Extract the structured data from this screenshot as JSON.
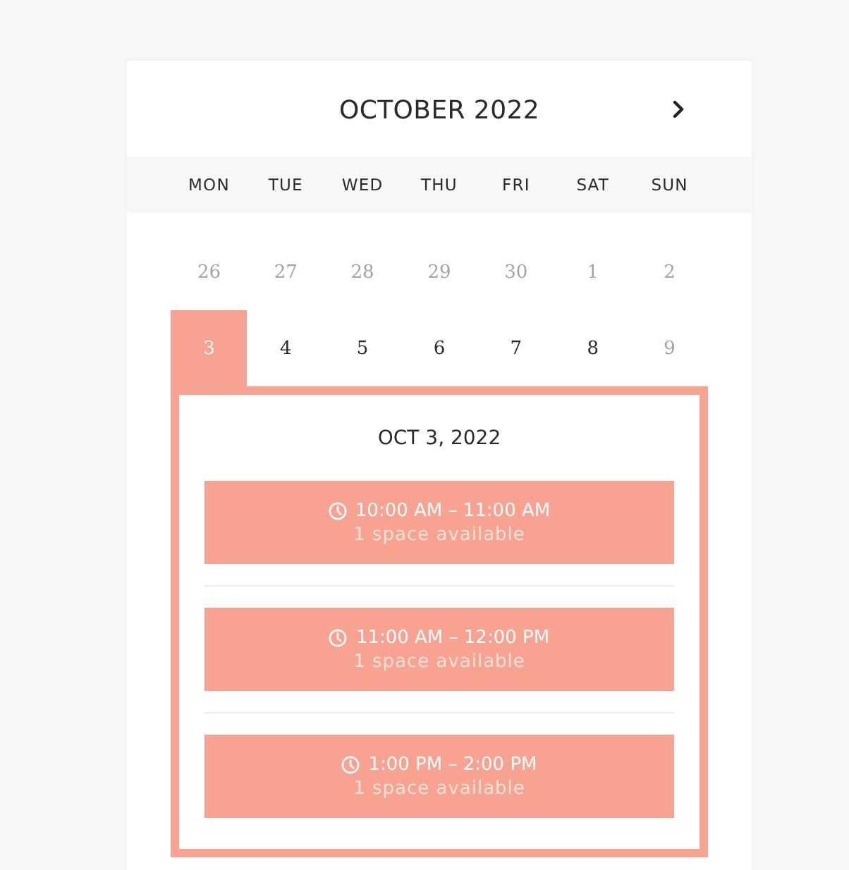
{
  "calendar": {
    "title": "OCTOBER 2022",
    "weekdays": [
      "MON",
      "TUE",
      "WED",
      "THU",
      "FRI",
      "SAT",
      "SUN"
    ],
    "weeks": [
      [
        {
          "day": "26",
          "available": false,
          "selected": false
        },
        {
          "day": "27",
          "available": false,
          "selected": false
        },
        {
          "day": "28",
          "available": false,
          "selected": false
        },
        {
          "day": "29",
          "available": false,
          "selected": false
        },
        {
          "day": "30",
          "available": false,
          "selected": false
        },
        {
          "day": "1",
          "available": false,
          "selected": false
        },
        {
          "day": "2",
          "available": false,
          "selected": false
        }
      ],
      [
        {
          "day": "3",
          "available": true,
          "selected": true
        },
        {
          "day": "4",
          "available": true,
          "selected": false
        },
        {
          "day": "5",
          "available": true,
          "selected": false
        },
        {
          "day": "6",
          "available": true,
          "selected": false
        },
        {
          "day": "7",
          "available": true,
          "selected": false
        },
        {
          "day": "8",
          "available": true,
          "selected": false
        },
        {
          "day": "9",
          "available": false,
          "selected": false
        }
      ]
    ],
    "selected_day": {
      "date": "OCT 3, 2022",
      "slots": [
        {
          "time": "10:00 AM – 11:00 AM",
          "availability": "1 space available"
        },
        {
          "time": "11:00 AM – 12:00 PM",
          "availability": "1 space available"
        },
        {
          "time": "1:00 PM – 2:00 PM",
          "availability": "1 space available"
        }
      ]
    }
  }
}
